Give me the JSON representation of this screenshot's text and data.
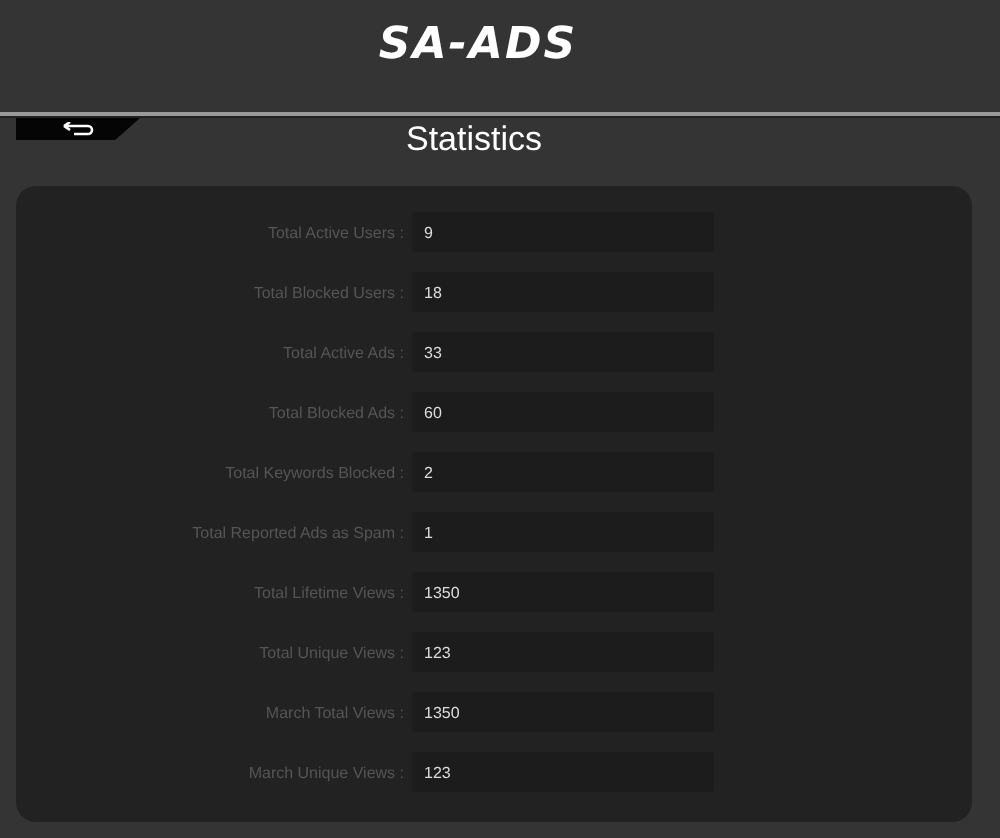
{
  "logo": "SA-ADS",
  "title": "Statistics",
  "stats": [
    {
      "label": "Total Active Users :",
      "value": "9"
    },
    {
      "label": "Total Blocked Users :",
      "value": "18"
    },
    {
      "label": "Total Active Ads :",
      "value": "33"
    },
    {
      "label": "Total Blocked Ads :",
      "value": "60"
    },
    {
      "label": "Total Keywords Blocked :",
      "value": "2"
    },
    {
      "label": "Total Reported Ads as Spam :",
      "value": "1"
    },
    {
      "label": "Total Lifetime Views :",
      "value": "1350"
    },
    {
      "label": "Total Unique Views :",
      "value": "123"
    },
    {
      "label": "March Total Views :",
      "value": "1350"
    },
    {
      "label": "March Unique Views :",
      "value": "123"
    }
  ]
}
